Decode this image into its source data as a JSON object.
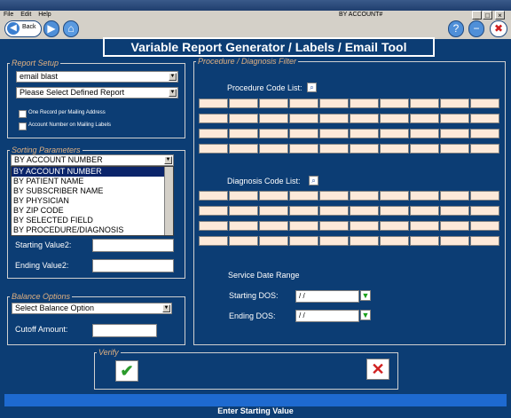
{
  "menu": {
    "file": "File",
    "edit": "Edit",
    "help": "Help",
    "account_label": "BY ACCOUNT#"
  },
  "window_buttons": {
    "minimize": "_",
    "maximize": "□",
    "close": "×"
  },
  "toolbar": {
    "back_label": "Back"
  },
  "header": {
    "title": "Variable Report Generator / Labels / Email Tool"
  },
  "report_setup": {
    "legend": "Report Setup",
    "report_value": "email blast",
    "defined_report_placeholder": "Please Select Defined Report",
    "opt1": "One Record per Mailing Address",
    "opt2": "Account Number on Mailing Labels"
  },
  "sorting": {
    "legend": "Sorting Parameters",
    "selected": "BY ACCOUNT NUMBER",
    "options": [
      "BY ACCOUNT NUMBER",
      "BY PATIENT NAME",
      "BY SUBSCRIBER NAME",
      "BY PHYSICIAN",
      "BY ZIP CODE",
      "BY SELECTED FIELD",
      "BY PROCEDURE/DIAGNOSIS"
    ],
    "starting_value2": "Starting Value2:",
    "ending_value2": "Ending  Value2:"
  },
  "balance": {
    "legend": "Balance Options",
    "select_label": "Select Balance Option",
    "cutoff_label": "Cutoff Amount:"
  },
  "filter": {
    "legend": "Procedure / Diagnosis Filter",
    "proc_label": "Procedure Code List:",
    "diag_label": "Diagnosis Code List:",
    "service_date_range": "Service Date Range",
    "starting_dos": "Starting DOS:",
    "ending_dos": "Ending   DOS:",
    "starting_dos_value": " / /",
    "ending_dos_value": " / /"
  },
  "verify": {
    "legend": "Verify"
  },
  "status": {
    "text": "Enter Starting Value"
  },
  "colors": {
    "background": "#0c3d74",
    "accent": "#1e6ad0",
    "cell": "#fde9d9"
  }
}
